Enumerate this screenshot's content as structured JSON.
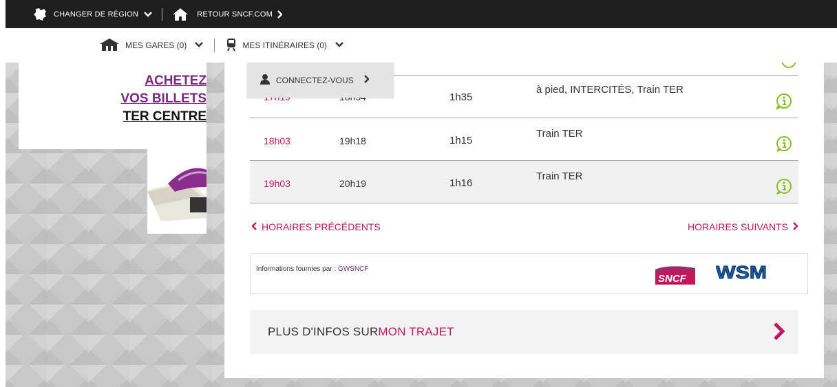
{
  "topbar": {
    "change_region": "CHANGER DE RÉGION",
    "back_link": "RETOUR SNCF.COM"
  },
  "navrow": {
    "my_stations": "MES GARES (0)",
    "my_itineraries": "MES ITINÉRAIRES (0)"
  },
  "dropdown": {
    "login": "CONNECTEZ-VOUS"
  },
  "promo": {
    "line1": "ACHETEZ",
    "line2": "VOS BILLETS",
    "line3": "TER CENTRE"
  },
  "timetable": {
    "rows": [
      {
        "departure": "17h19",
        "arrival": "18h54",
        "duration": "1h35",
        "mode": "à pied, INTERCITÉS, Train TER"
      },
      {
        "departure": "18h03",
        "arrival": "19h18",
        "duration": "1h15",
        "mode": "Train TER"
      },
      {
        "departure": "19h03",
        "arrival": "20h19",
        "duration": "1h16",
        "mode": "Train TER"
      }
    ]
  },
  "pagination": {
    "previous": "HORAIRES PRÉCÉDENTS",
    "next": "HORAIRES SUIVANTS"
  },
  "info": {
    "provided_by": "Informations fournies par : ",
    "source": "GWSNCF",
    "logo_sncf": "SNCF",
    "logo_wsm": "WSM"
  },
  "more": {
    "prefix": "PLUS D'INFOS SUR",
    "accent": "MON TRAJET"
  },
  "colors": {
    "accent": "#c2185b",
    "purple": "#7a2a7e",
    "info_green": "#8cbf26",
    "topbar": "#1e1e1e"
  }
}
